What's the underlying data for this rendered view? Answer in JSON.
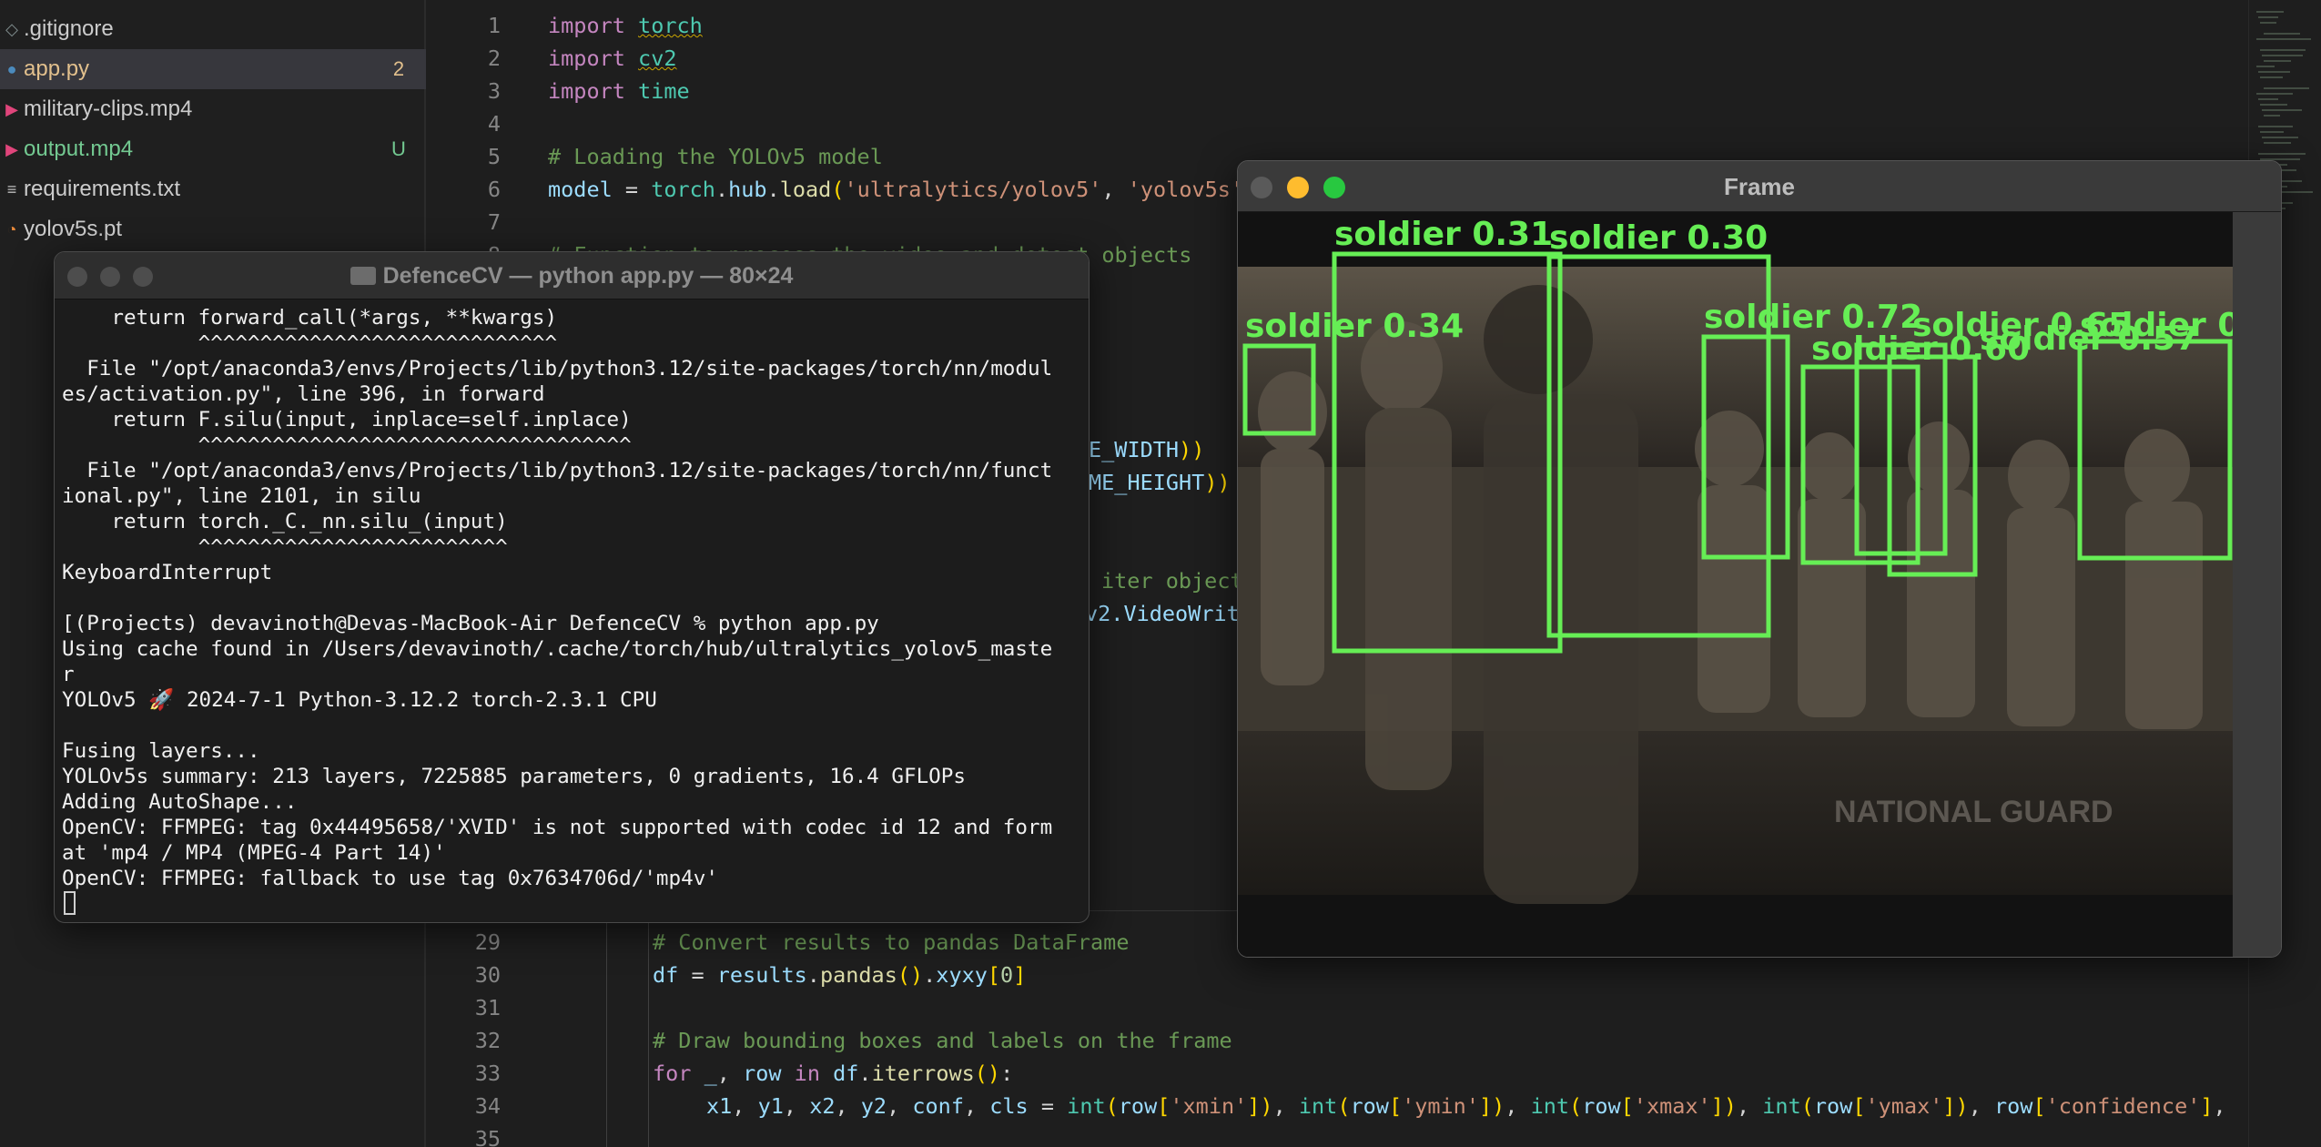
{
  "explorer": {
    "files": [
      {
        "name": ".gitignore",
        "icon": "gitignore-icon",
        "color": "#cccccc",
        "badge": "",
        "active": false
      },
      {
        "name": "app.py",
        "icon": "python-file-icon",
        "color": "#e2c08d",
        "badge": "2",
        "badge_color": "#e2c08d",
        "active": true
      },
      {
        "name": "military-clips.mp4",
        "icon": "video-file-icon",
        "color": "#cccccc",
        "badge": "",
        "active": false
      },
      {
        "name": "output.mp4",
        "icon": "video-file-icon",
        "color": "#73c991",
        "badge": "U",
        "badge_color": "#73c991",
        "active": false
      },
      {
        "name": "requirements.txt",
        "icon": "text-file-icon",
        "color": "#cccccc",
        "badge": "",
        "active": false
      },
      {
        "name": "yolov5s.pt",
        "icon": "rss-file-icon",
        "color": "#cccccc",
        "badge": "",
        "active": false
      }
    ]
  },
  "editor": {
    "lines_top": [
      {
        "n": "1",
        "tokens": [
          [
            "kw",
            "import"
          ],
          [
            "",
            "&nbsp;"
          ],
          [
            "mod sq",
            "torch"
          ]
        ]
      },
      {
        "n": "2",
        "tokens": [
          [
            "kw",
            "import"
          ],
          [
            "",
            "&nbsp;"
          ],
          [
            "mod sq",
            "cv2"
          ]
        ]
      },
      {
        "n": "3",
        "tokens": [
          [
            "kw",
            "import"
          ],
          [
            "",
            "&nbsp;"
          ],
          [
            "mod",
            "time"
          ]
        ]
      },
      {
        "n": "4",
        "tokens": []
      },
      {
        "n": "5",
        "tokens": [
          [
            "cm",
            "# Loading the YOLOv5 model"
          ]
        ]
      },
      {
        "n": "6",
        "tokens": [
          [
            "var",
            "model"
          ],
          [
            "",
            "&nbsp;=&nbsp;"
          ],
          [
            "mod",
            "torch"
          ],
          [
            "",
            "."
          ],
          [
            "var",
            "hub"
          ],
          [
            "",
            "."
          ],
          [
            "fn",
            "load"
          ],
          [
            "pun",
            "("
          ],
          [
            "str",
            "'ultralytics/yolov5'"
          ],
          [
            "",
            ",&nbsp;"
          ],
          [
            "str",
            "'yolov5s'"
          ]
        ]
      },
      {
        "n": "7",
        "tokens": []
      },
      {
        "n": "8",
        "tokens": [
          [
            "cm",
            "# Function to process the video and detect objects"
          ]
        ]
      }
    ],
    "partial_fragments": [
      {
        "text": "E_WIDTH",
        "close": "))"
      },
      {
        "text": "ME_HEIGHT",
        "close": "))"
      },
      {
        "text": "iter object",
        "close": ""
      },
      {
        "text": "v2.VideoWrit",
        "close": ""
      }
    ],
    "lines_bottom": [
      {
        "n": "29",
        "tokens": [
          [
            "cm",
            "# Convert results to pandas DataFrame"
          ]
        ]
      },
      {
        "n": "30",
        "tokens": [
          [
            "var",
            "df"
          ],
          [
            "",
            "&nbsp;=&nbsp;"
          ],
          [
            "var",
            "results"
          ],
          [
            "",
            "."
          ],
          [
            "fn",
            "pandas"
          ],
          [
            "pun",
            "()"
          ],
          [
            "",
            "."
          ],
          [
            "var",
            "xyxy"
          ],
          [
            "pun",
            "["
          ],
          [
            "num",
            "0"
          ],
          [
            "pun",
            "]"
          ]
        ]
      },
      {
        "n": "31",
        "tokens": []
      },
      {
        "n": "32",
        "tokens": [
          [
            "cm",
            "# Draw bounding boxes and labels on the frame"
          ]
        ]
      },
      {
        "n": "33",
        "tokens": [
          [
            "kw",
            "for"
          ],
          [
            "",
            "&nbsp;"
          ],
          [
            "var",
            "_"
          ],
          [
            "",
            ",&nbsp;"
          ],
          [
            "var",
            "row"
          ],
          [
            "",
            "&nbsp;"
          ],
          [
            "kw",
            "in"
          ],
          [
            "",
            "&nbsp;"
          ],
          [
            "var",
            "df"
          ],
          [
            "",
            "."
          ],
          [
            "fn",
            "iterrows"
          ],
          [
            "pun",
            "()"
          ],
          [
            "",
            ":"
          ]
        ]
      },
      {
        "n": "34",
        "tokens": [
          [
            "var",
            "x1"
          ],
          [
            "",
            ",&nbsp;"
          ],
          [
            "var",
            "y1"
          ],
          [
            "",
            ",&nbsp;"
          ],
          [
            "var",
            "x2"
          ],
          [
            "",
            ",&nbsp;"
          ],
          [
            "var",
            "y2"
          ],
          [
            "",
            ",&nbsp;"
          ],
          [
            "var",
            "conf"
          ],
          [
            "",
            ",&nbsp;"
          ],
          [
            "var",
            "cls"
          ],
          [
            "",
            "&nbsp;=&nbsp;"
          ],
          [
            "mod",
            "int"
          ],
          [
            "pun",
            "("
          ],
          [
            "var",
            "row"
          ],
          [
            "pun",
            "["
          ],
          [
            "str",
            "'xmin'"
          ],
          [
            "pun",
            "])"
          ],
          [
            "",
            ",&nbsp;"
          ],
          [
            "mod",
            "int"
          ],
          [
            "pun",
            "("
          ],
          [
            "var",
            "row"
          ],
          [
            "pun",
            "["
          ],
          [
            "str",
            "'ymin'"
          ],
          [
            "pun",
            "])"
          ],
          [
            "",
            ",&nbsp;"
          ],
          [
            "mod",
            "int"
          ],
          [
            "pun",
            "("
          ],
          [
            "var",
            "row"
          ],
          [
            "pun",
            "["
          ],
          [
            "str",
            "'xmax'"
          ],
          [
            "pun",
            "])"
          ],
          [
            "",
            ",&nbsp;"
          ],
          [
            "mod",
            "int"
          ],
          [
            "pun",
            "("
          ],
          [
            "var",
            "row"
          ],
          [
            "pun",
            "["
          ],
          [
            "str",
            "'ymax'"
          ],
          [
            "pun",
            "])"
          ],
          [
            "",
            ",&nbsp;"
          ],
          [
            "var",
            "row"
          ],
          [
            "pun",
            "["
          ],
          [
            "str",
            "'confidence'"
          ],
          [
            "pun",
            "]"
          ],
          [
            "",
            ","
          ]
        ]
      },
      {
        "n": "35",
        "tokens": []
      }
    ]
  },
  "terminal": {
    "title": "DefenceCV — python app.py — 80×24",
    "lines": [
      "    return forward_call(*args, **kwargs)",
      "           ^^^^^^^^^^^^^^^^^^^^^^^^^^^^^",
      "  File \"/opt/anaconda3/envs/Projects/lib/python3.12/site-packages/torch/nn/modul",
      "es/activation.py\", line 396, in forward",
      "    return F.silu(input, inplace=self.inplace)",
      "           ^^^^^^^^^^^^^^^^^^^^^^^^^^^^^^^^^^^",
      "  File \"/opt/anaconda3/envs/Projects/lib/python3.12/site-packages/torch/nn/funct",
      "ional.py\", line 2101, in silu",
      "    return torch._C._nn.silu_(input)",
      "           ^^^^^^^^^^^^^^^^^^^^^^^^^",
      "KeyboardInterrupt",
      "",
      "[(Projects) devavinoth@Devas-MacBook-Air DefenceCV % python app.py",
      "Using cache found in /Users/devavinoth/.cache/torch/hub/ultralytics_yolov5_maste",
      "r",
      "YOLOv5 🚀 2024-7-1 Python-3.12.2 torch-2.3.1 CPU",
      "",
      "Fusing layers...",
      "YOLOv5s summary: 213 layers, 7225885 parameters, 0 gradients, 16.4 GFLOPs",
      "Adding AutoShape...",
      "OpenCV: FFMPEG: tag 0x44495658/'XVID' is not supported with codec id 12 and form",
      "at 'mp4 / MP4 (MPEG-4 Part 14)'",
      "OpenCV: FFMPEG: fallback to use tag 0x7634706d/'mp4v'"
    ]
  },
  "frame_window": {
    "title": "Frame",
    "video_caption": "NATIONAL GUARD",
    "detections": [
      {
        "label": "soldier 0.31"
      },
      {
        "label": "soldier 0.30"
      },
      {
        "label": "soldier 0.34"
      },
      {
        "label": "soldier 0.72"
      },
      {
        "label": "soldier 0.65"
      },
      {
        "label": "soldier 0.60"
      },
      {
        "label": "soldier 0.57"
      },
      {
        "label": "soldier 0."
      }
    ]
  },
  "colors": {
    "detection_box": "#66ee55",
    "traffic_close": "#ff5f57",
    "traffic_min": "#febc2e",
    "traffic_max": "#28c840"
  }
}
